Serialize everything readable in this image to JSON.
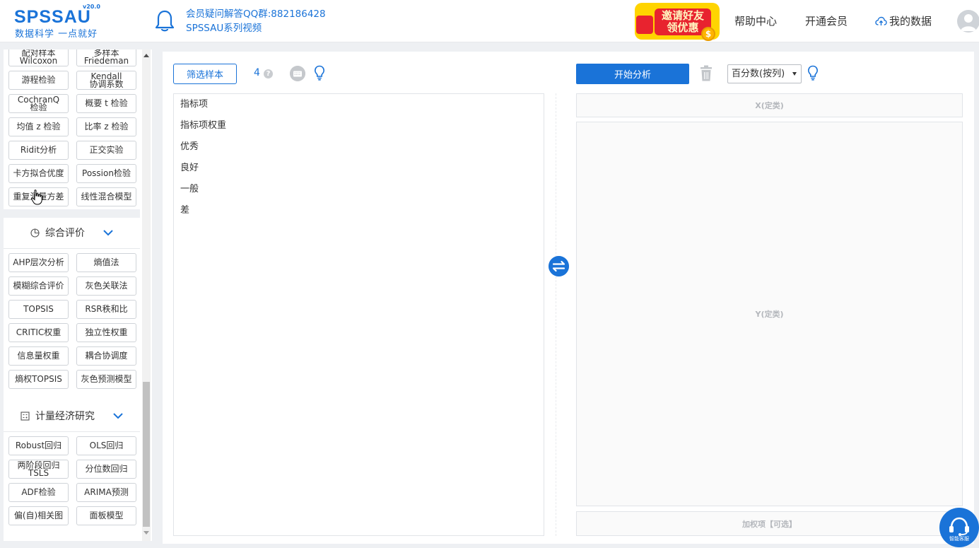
{
  "header": {
    "logo_text": "SPSSAU",
    "logo_version": "v20.0",
    "logo_slogan": "数据科学  一点就好",
    "notice_line1": "会员疑问解答QQ群:882186428",
    "notice_line2": "SPSSAU系列视频",
    "promo_line1": "邀请好友",
    "promo_line2": "领优惠",
    "promo_coin": "$",
    "nav_help": "帮助中心",
    "nav_vip": "开通会员",
    "nav_data": "我的数据"
  },
  "sidebar": {
    "top_buttons": [
      {
        "label": "配对样本\nWilcoxon"
      },
      {
        "label": "多样本\nFriedeman"
      },
      {
        "label": "游程检验"
      },
      {
        "label": "Kendall\n协调系数"
      },
      {
        "label": "CochranQ\n检验"
      },
      {
        "label": "概要 t 检验"
      },
      {
        "label": "均值 z 检验"
      },
      {
        "label": "比率 z 检验"
      },
      {
        "label": "Ridit分析"
      },
      {
        "label": "正交实验"
      },
      {
        "label": "卡方拟合优度"
      },
      {
        "label": "Possion检验"
      },
      {
        "label": "重复测量方差"
      },
      {
        "label": "线性混合模型"
      }
    ],
    "section_eval": "综合评价",
    "eval_buttons": [
      {
        "label": "AHP层次分析"
      },
      {
        "label": "熵值法"
      },
      {
        "label": "模糊综合评价"
      },
      {
        "label": "灰色关联法"
      },
      {
        "label": "TOPSIS"
      },
      {
        "label": "RSR秩和比"
      },
      {
        "label": "CRITIC权重"
      },
      {
        "label": "独立性权重"
      },
      {
        "label": "信息量权重"
      },
      {
        "label": "耦合协调度"
      },
      {
        "label": "熵权TOPSIS"
      },
      {
        "label": "灰色预测模型"
      }
    ],
    "section_econ": "计量经济研究",
    "econ_buttons": [
      {
        "label": "Robust回归"
      },
      {
        "label": "OLS回归"
      },
      {
        "label": "两阶段回归\nTSLS"
      },
      {
        "label": "分位数回归"
      },
      {
        "label": "ADF检验"
      },
      {
        "label": "ARIMA预测"
      },
      {
        "label": "偏(自)相关图"
      },
      {
        "label": "面板模型"
      }
    ]
  },
  "main": {
    "filter_label": "筛选样本",
    "sample_count": "4",
    "help_mark": "?",
    "variables": [
      {
        "label": "指标项"
      },
      {
        "label": "指标项权重"
      },
      {
        "label": "优秀"
      },
      {
        "label": "良好"
      },
      {
        "label": "一般"
      },
      {
        "label": "差"
      }
    ],
    "start_label": "开始分析",
    "select_value": "百分数(按列)",
    "dropzone_x": "X(定类)",
    "dropzone_y": "Y(定类)",
    "dropzone_weight": "加权项【可选】"
  },
  "support": {
    "label": "智能客服"
  },
  "colors": {
    "brand": "#1a73d8",
    "promo_red": "#e8232f",
    "promo_yellow": "#ffd400"
  }
}
